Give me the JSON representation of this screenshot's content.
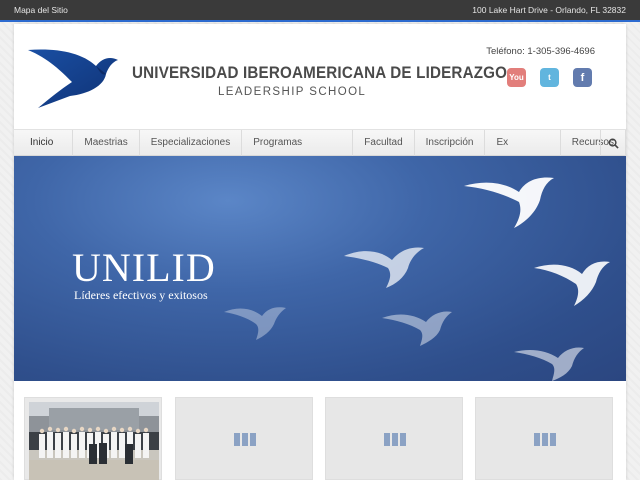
{
  "topbar": {
    "sitemap_link": "Mapa del Sitio",
    "address": "100 Lake Hart Drive - Orlando, FL 32832"
  },
  "header": {
    "logo_icon": "bird-logo-icon",
    "university_name": "UNIVERSIDAD IBEROAMERICANA DE LIDERAZGO",
    "school_name": "LEADERSHIP SCHOOL",
    "phone": "Teléfono: 1-305-396-4696",
    "social": [
      {
        "name": "youtube",
        "label": "You"
      },
      {
        "name": "twitter",
        "label": "t"
      },
      {
        "name": "facebook",
        "label": "f"
      }
    ]
  },
  "nav": {
    "items": [
      {
        "label": "Inicio »"
      },
      {
        "label": "Maestrias"
      },
      {
        "label": "Especializaciones"
      },
      {
        "label": "Programas ONLINE"
      },
      {
        "label": "Facultad"
      },
      {
        "label": "Inscripción"
      },
      {
        "label": "Ex Alumnos"
      },
      {
        "label": "Recursos"
      }
    ],
    "search_icon": "search-icon"
  },
  "hero": {
    "title": "UNILID",
    "tagline": "Líderes efectivos y exitosos"
  },
  "colors": {
    "topbar_bg": "#3a3a3a",
    "accent": "#2d6bd0",
    "hero_blue": "#3f66a8"
  }
}
